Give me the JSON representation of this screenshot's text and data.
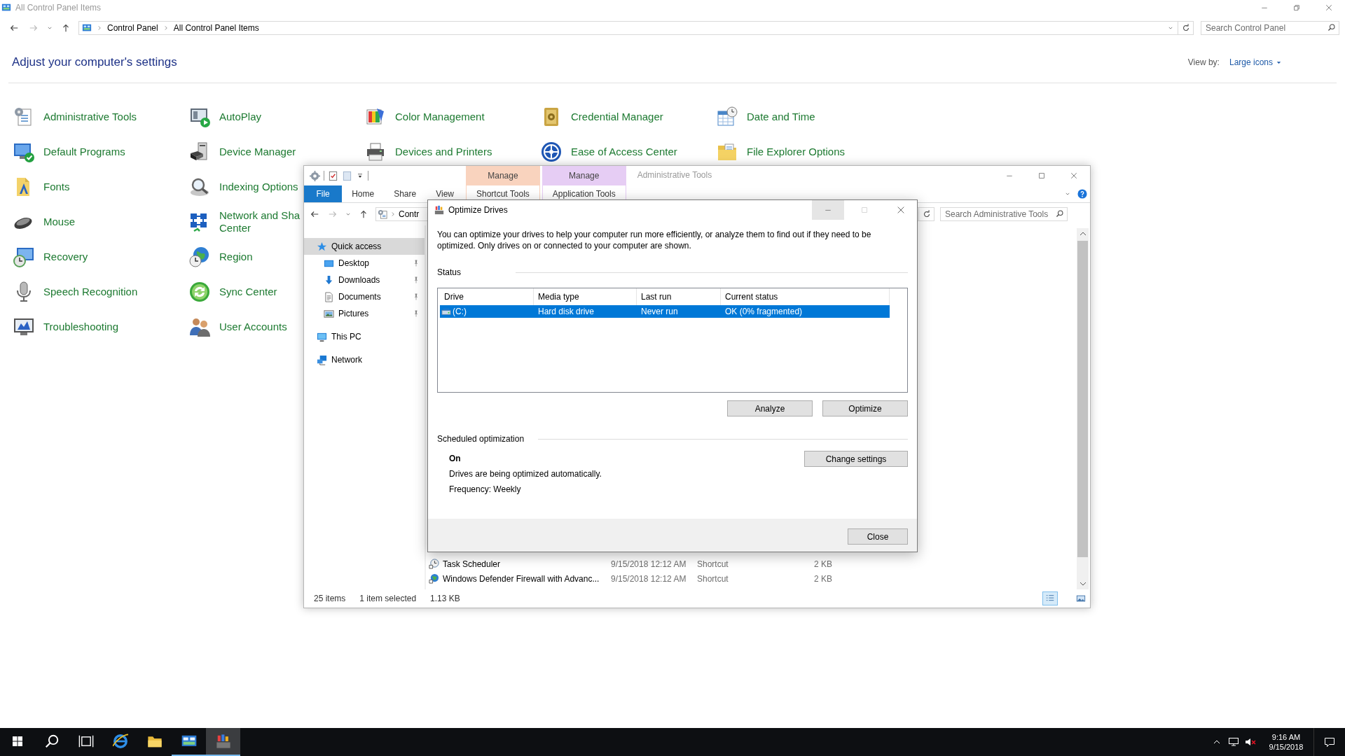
{
  "control_panel": {
    "title": "All Control Panel Items",
    "breadcrumb": [
      "Control Panel",
      "All Control Panel Items"
    ],
    "search": {
      "placeholder": "Search Control Panel"
    },
    "heading": "Adjust your computer's settings",
    "view_by": {
      "label": "View by:",
      "value": "Large icons"
    },
    "item_rows": [
      [
        {
          "label": "Administrative Tools"
        },
        {
          "label": "AutoPlay"
        },
        {
          "label": "Color Management"
        },
        {
          "label": "Credential Manager"
        },
        {
          "label": "Date and Time"
        }
      ],
      [
        {
          "label": "Default Programs"
        },
        {
          "label": "Device Manager"
        },
        {
          "label": "Devices and Printers"
        },
        {
          "label": "Ease of Access Center"
        },
        {
          "label": "File Explorer Options"
        }
      ],
      [
        {
          "label": "Fonts"
        },
        {
          "label": "Indexing Options"
        }
      ],
      [
        {
          "label": "Mouse"
        },
        {
          "label": "Network and Sha\nCenter"
        }
      ],
      [
        {
          "label": "Recovery"
        },
        {
          "label": "Region"
        }
      ],
      [
        {
          "label": "Speech Recognition"
        },
        {
          "label": "Sync Center"
        }
      ],
      [
        {
          "label": "Troubleshooting"
        },
        {
          "label": "User Accounts"
        }
      ]
    ]
  },
  "explorer": {
    "title": "Administrative Tools",
    "tabs": [
      {
        "label": "File",
        "kind": "file"
      },
      {
        "label": "Home",
        "kind": "plain"
      },
      {
        "label": "Share",
        "kind": "plain"
      },
      {
        "label": "View",
        "kind": "plain"
      },
      {
        "label": "Shortcut Tools",
        "kind": "context",
        "group": "Manage",
        "color": "#f9d3be"
      },
      {
        "label": "Application Tools",
        "kind": "context",
        "group": "Manage",
        "color": "#e6cdf4"
      }
    ],
    "address": "Contr",
    "search": {
      "placeholder": "Search Administrative Tools"
    },
    "nav": [
      {
        "label": "Quick access",
        "selected": true,
        "children": [
          {
            "label": "Desktop",
            "pinned": true
          },
          {
            "label": "Downloads",
            "pinned": true
          },
          {
            "label": "Documents",
            "pinned": true
          },
          {
            "label": "Pictures",
            "pinned": true
          }
        ]
      },
      {
        "label": "This PC",
        "selected": false
      },
      {
        "label": "Network",
        "selected": false
      }
    ],
    "files": [
      {
        "name": "Task Scheduler",
        "modified": "9/15/2018 12:12 AM",
        "type": "Shortcut",
        "size": "2 KB"
      },
      {
        "name": "Windows Defender Firewall with Advanc...",
        "modified": "9/15/2018 12:12 AM",
        "type": "Shortcut",
        "size": "2 KB"
      }
    ],
    "status_bar": {
      "item_count": "25 items",
      "selection": "1 item selected",
      "selection_size": "1.13 KB"
    }
  },
  "dialog": {
    "title": "Optimize Drives",
    "description": "You can optimize your drives to help your computer run more efficiently, or analyze them to find out if they need to be optimized. Only drives on or connected to your computer are shown.",
    "status_label": "Status",
    "columns": [
      "Drive",
      "Media type",
      "Last run",
      "Current status"
    ],
    "drives": [
      {
        "drive": "(C:)",
        "media_type": "Hard disk drive",
        "last_run": "Never run",
        "current_status": "OK (0% fragmented)",
        "selected": true
      }
    ],
    "actions": [
      "Analyze",
      "Optimize"
    ],
    "schedule": {
      "label": "Scheduled optimization",
      "state": "On",
      "description": "Drives are being optimized automatically.",
      "frequency": "Frequency: Weekly",
      "button": "Change settings"
    },
    "close_button": "Close"
  },
  "taskbar": {
    "apps": [
      {
        "kind": "start",
        "running": false,
        "active": false
      },
      {
        "kind": "search",
        "running": false,
        "active": false
      },
      {
        "kind": "task_view",
        "running": false,
        "active": false
      },
      {
        "kind": "browser",
        "running": false,
        "active": false
      },
      {
        "kind": "file_explorer",
        "running": false,
        "active": false
      },
      {
        "kind": "control_panel",
        "running": true,
        "active": false
      },
      {
        "kind": "defragmenter",
        "running": true,
        "active": true
      }
    ],
    "clock": {
      "time": "9:16 AM",
      "date": "9/15/2018"
    }
  }
}
